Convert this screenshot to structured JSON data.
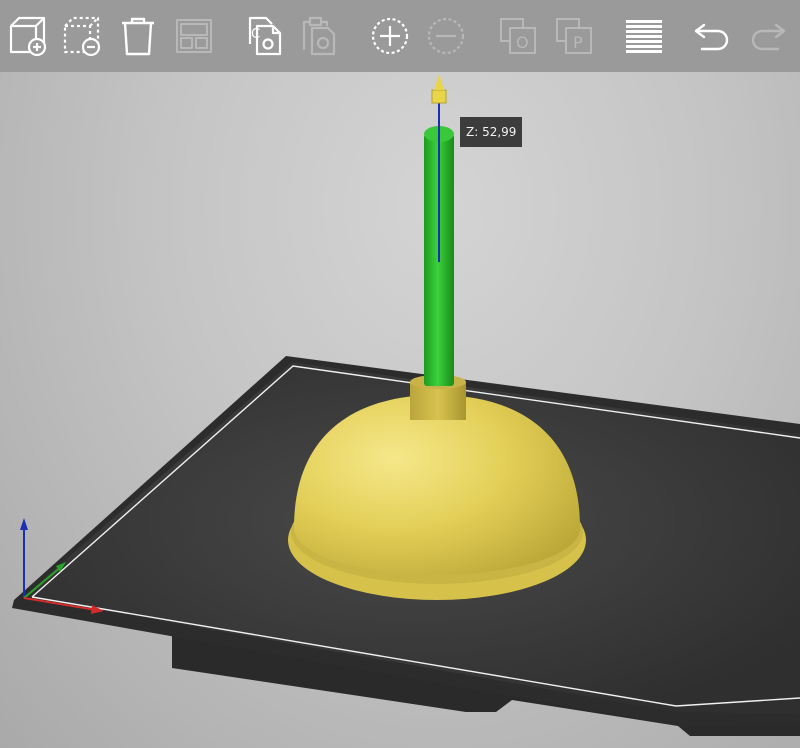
{
  "toolbar": {
    "items": [
      {
        "id": "add",
        "icon": "add-object-icon",
        "enabled": true
      },
      {
        "id": "delete",
        "icon": "delete-object-icon",
        "enabled": true
      },
      {
        "id": "delete_all",
        "icon": "trash-icon",
        "enabled": true
      },
      {
        "id": "arrange",
        "icon": "arrange-icon",
        "enabled": false
      },
      {
        "id": "copy",
        "icon": "copy-icon",
        "enabled": true
      },
      {
        "id": "paste",
        "icon": "paste-icon",
        "enabled": false
      },
      {
        "id": "add_instance",
        "icon": "plus-circle-icon",
        "enabled": true
      },
      {
        "id": "remove_instance",
        "icon": "minus-circle-icon",
        "enabled": false
      },
      {
        "id": "split_objects",
        "icon": "split-objects-icon",
        "enabled": false
      },
      {
        "id": "split_parts",
        "icon": "split-parts-icon",
        "enabled": false
      },
      {
        "id": "layers",
        "icon": "layers-icon",
        "enabled": true
      },
      {
        "id": "undo",
        "icon": "undo-icon",
        "enabled": true
      },
      {
        "id": "redo",
        "icon": "redo-icon",
        "enabled": false
      }
    ],
    "split_objects_letter": "O",
    "split_parts_letter": "P"
  },
  "viewport": {
    "z_tooltip": "Z: 52,99"
  },
  "colors": {
    "toolbar_bg": "#9a9a9a",
    "icon_enabled": "#ffffff",
    "icon_disabled": "#bdbdbd",
    "bed_surface": "#383838",
    "bed_border": "#f0f0f0",
    "model": "#e6d25e",
    "selected_part": "#2fbf2f",
    "axis_x": "#d42a2a",
    "axis_y": "#27a327",
    "axis_z": "#1c2fb4",
    "gizmo": "#e8d54a"
  }
}
